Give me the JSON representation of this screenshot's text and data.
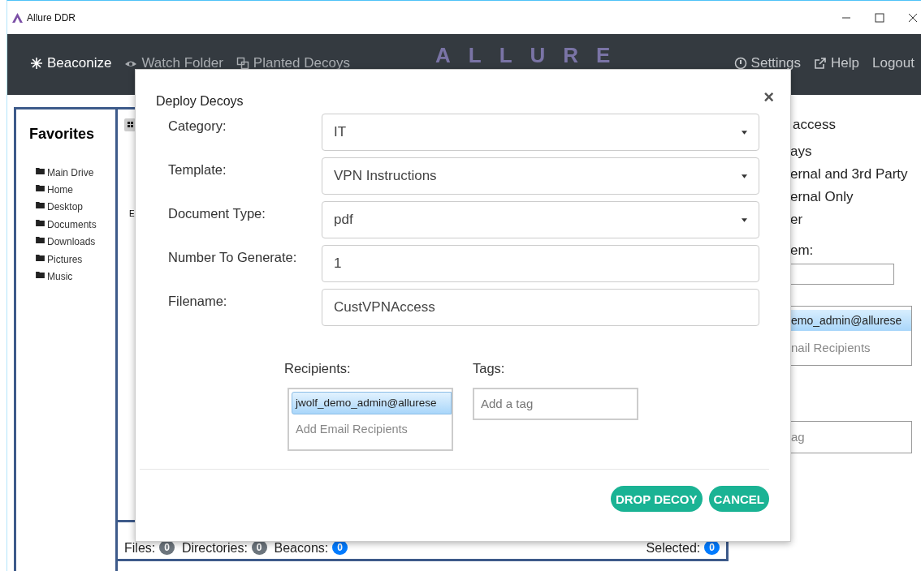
{
  "window": {
    "title": "Allure DDR"
  },
  "nav": {
    "left": [
      {
        "label": "Beaconize",
        "selected": true
      },
      {
        "label": "Watch Folder",
        "selected": false
      },
      {
        "label": "Planted Decoys",
        "selected": false
      }
    ],
    "logo": "ALLURE",
    "right": [
      {
        "label": "Settings"
      },
      {
        "label": "Help"
      },
      {
        "label": "Logout"
      }
    ]
  },
  "favorites": {
    "title": "Favorites",
    "items": [
      "Main Drive",
      "Home",
      "Desktop",
      "Documents",
      "Downloads",
      "Pictures",
      "Music"
    ]
  },
  "center": {
    "fragment": "E"
  },
  "status_bar": [
    {
      "label": "Files:",
      "count": "0",
      "color": "#6c757d"
    },
    {
      "label": "Directories:",
      "count": "0",
      "color": "#6c757d"
    },
    {
      "label": "Beacons:",
      "count": "0",
      "color": "#007bff"
    },
    {
      "label": "Selected:",
      "count": "0",
      "color": "#007bff"
    }
  ],
  "right_panel": {
    "lines": [
      "access",
      "ays",
      "ernal and 3rd Party",
      "ernal Only",
      "er"
    ],
    "field_label": "em:",
    "recipient_chip": "emo_admin@allurese",
    "recipient_placeholder": "nail Recipients",
    "tag_placeholder": "ag"
  },
  "dialog": {
    "title": "Deploy Decoys",
    "close": "×",
    "fields": [
      {
        "label": "Category:",
        "kind": "select",
        "value": "IT"
      },
      {
        "label": "Template:",
        "kind": "select",
        "value": "VPN Instructions"
      },
      {
        "label": "Document Type:",
        "kind": "select",
        "value": "pdf"
      },
      {
        "label": "Number To Generate:",
        "kind": "text",
        "value": "1"
      },
      {
        "label": "Filename:",
        "kind": "text",
        "value": "CustVPNAccess"
      }
    ],
    "recipients": {
      "label": "Recipients:",
      "chips": [
        "jwolf_demo_admin@allurese"
      ],
      "placeholder": "Add Email Recipients"
    },
    "tags": {
      "label": "Tags:",
      "placeholder": "Add a tag"
    },
    "buttons": [
      "DROP DECOY",
      "CANCEL"
    ]
  }
}
